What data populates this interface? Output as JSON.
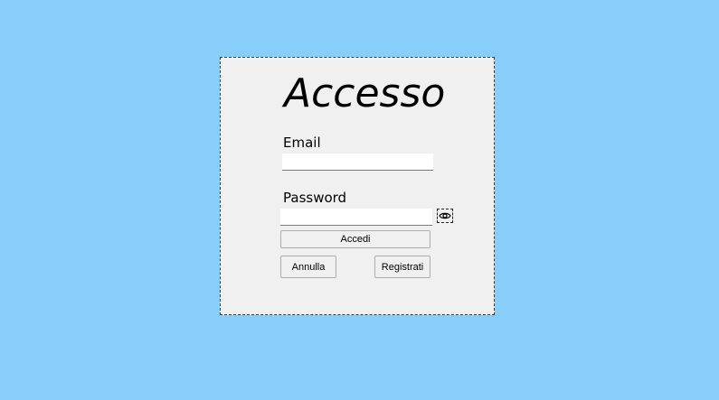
{
  "login": {
    "title": "Accesso",
    "email_label": "Email",
    "email_value": "",
    "password_label": "Password",
    "password_value": "",
    "show_password_icon": "eye-icon",
    "login_button": "Accedi",
    "cancel_button": "Annulla",
    "register_button": "Registrati"
  },
  "colors": {
    "background": "#87CEFA",
    "panel": "#F0F0F0"
  }
}
